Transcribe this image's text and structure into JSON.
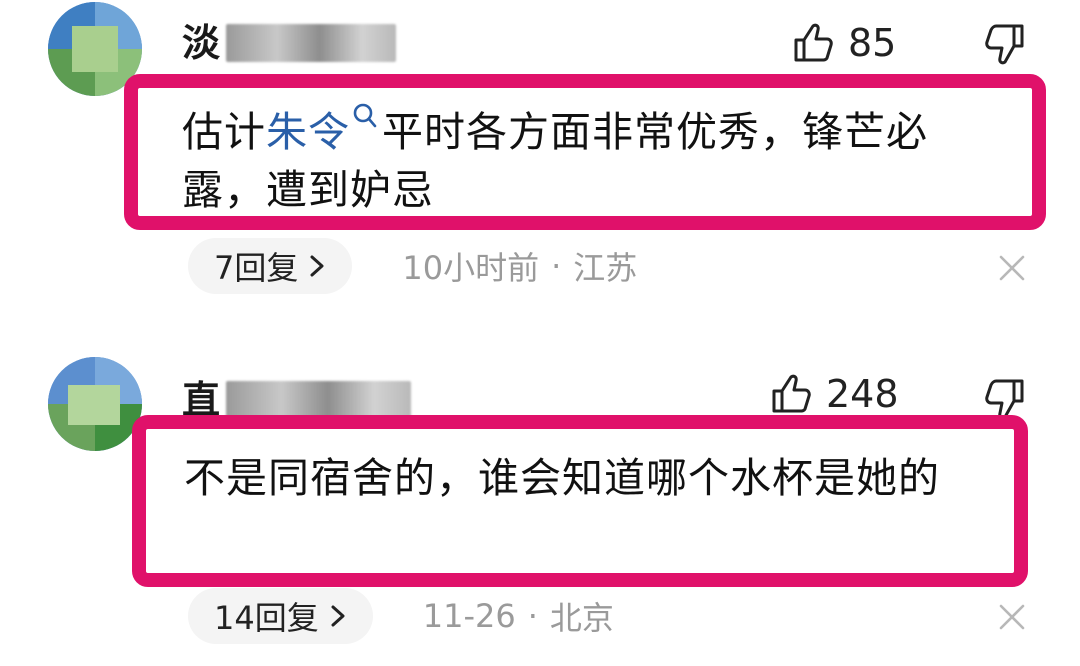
{
  "comments": [
    {
      "username_visible": "淡",
      "likes": "85",
      "body_before": "估计",
      "body_keyword": "朱令",
      "body_after": "平时各方面非常优秀，锋芒必露，遭到妒忌",
      "reply_count": "7回复",
      "time": "10小时前",
      "separator": "·",
      "location": "江苏",
      "icons": [
        "avatar-image",
        "thumb-up-icon",
        "thumb-down-icon",
        "search-icon",
        "chevron-right-icon",
        "close-icon"
      ]
    },
    {
      "username_visible": "直",
      "likes": "248",
      "body": "不是同宿舍的，谁会知道哪个水杯是她的",
      "reply_count": "14回复",
      "time": "11-26",
      "separator": "·",
      "location": "北京",
      "icons": [
        "avatar-image",
        "thumb-up-icon",
        "thumb-down-icon",
        "chevron-right-icon",
        "close-icon"
      ]
    }
  ],
  "colors": {
    "highlight_border": "#e0116a",
    "keyword_link": "#2a5fa8",
    "meta_gray": "#9a9a9a",
    "chip_bg": "#f4f4f4"
  }
}
